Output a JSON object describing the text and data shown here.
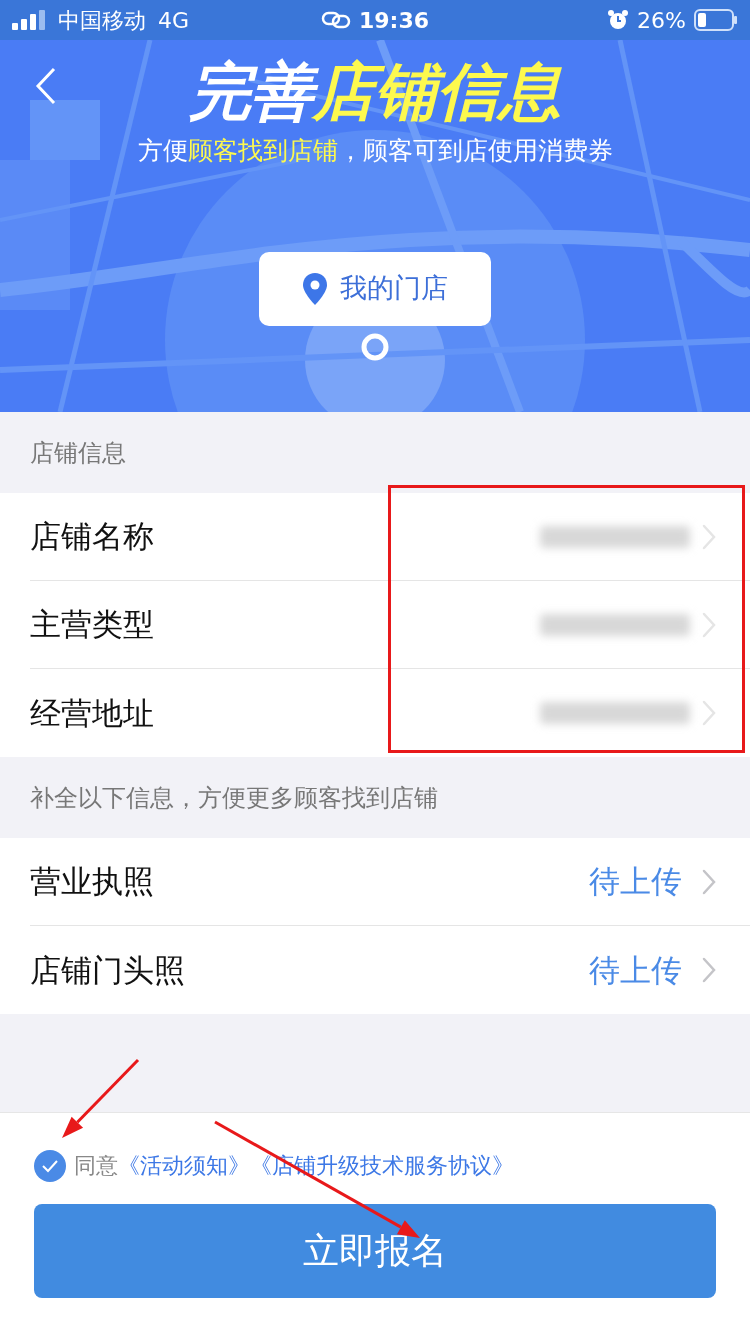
{
  "status_bar": {
    "carrier": "中国移动",
    "network": "4G",
    "time": "19:36",
    "battery": "26%"
  },
  "header": {
    "title": [
      {
        "text": "完善",
        "highlight": false
      },
      {
        "text": "店铺信息",
        "highlight": true
      }
    ],
    "subtitle": [
      {
        "text": "方便",
        "highlight": false
      },
      {
        "text": "顾客找到店铺",
        "highlight": true
      },
      {
        "text": "，顾客可到店使用消费券",
        "highlight": false
      }
    ]
  },
  "map_pin": {
    "label": "我的门店"
  },
  "sections": [
    {
      "heading": "店铺信息",
      "rows": [
        {
          "label": "店铺名称",
          "kind": "blurred"
        },
        {
          "label": "主营类型",
          "kind": "blurred"
        },
        {
          "label": "经营地址",
          "kind": "blurred"
        }
      ]
    },
    {
      "heading": "补全以下信息，方便更多顾客找到店铺",
      "rows": [
        {
          "label": "营业执照",
          "kind": "status",
          "value": "待上传"
        },
        {
          "label": "店铺门头照",
          "kind": "status",
          "value": "待上传"
        }
      ]
    }
  ],
  "agreement": {
    "checked": true,
    "prefix": "同意",
    "links": [
      "《活动须知》",
      "《店铺升级技术服务协议》"
    ]
  },
  "submit_button": "立即报名",
  "annotations": [
    {
      "kind": "box"
    },
    {
      "kind": "arrow"
    },
    {
      "kind": "arrow"
    }
  ]
}
